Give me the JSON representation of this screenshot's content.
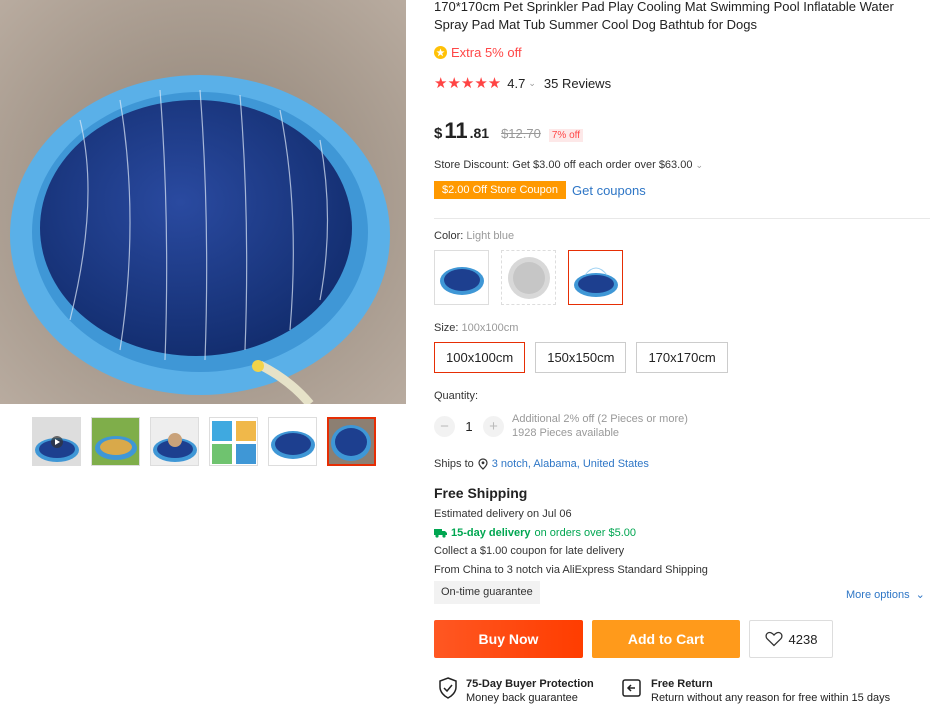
{
  "product": {
    "title": "170*170cm Pet Sprinkler Pad Play Cooling Mat Swimming Pool Inflatable Water Spray Pad Mat Tub Summer Cool Dog Bathtub for Dogs",
    "extra_off": "Extra 5% off",
    "rating": "4.7",
    "reviews": "35 Reviews",
    "price_currency": "$",
    "price_int": "11",
    "price_dec": ".81",
    "price_old": "$12.70",
    "price_off": "7% off",
    "star_rating_value": 4.7
  },
  "store": {
    "discount": "Store Discount: Get $3.00 off each order over $63.00",
    "coupon": "$2.00 Off Store Coupon",
    "get_coupons": "Get coupons"
  },
  "color": {
    "label": "Color:",
    "value": "Light blue"
  },
  "size": {
    "label": "Size:",
    "value": "100x100cm",
    "options": [
      "100x100cm",
      "150x150cm",
      "170x170cm"
    ]
  },
  "quantity": {
    "label": "Quantity:",
    "value": "1",
    "note1": "Additional 2% off (2 Pieces or more)",
    "note2": "1928 Pieces available",
    "minus": "−",
    "plus": "+"
  },
  "ships": {
    "label": "Ships to",
    "location": "3 notch, Alabama, United States"
  },
  "shipping": {
    "title": "Free Shipping",
    "estimate": "Estimated delivery on Jul 06",
    "delivery_bold": "15-day delivery",
    "delivery_rest": "on orders over $5.00",
    "late": "Collect a $1.00 coupon for late delivery",
    "from": "From China to 3 notch via AliExpress Standard Shipping",
    "ontime": "On-time guarantee",
    "more": "More options"
  },
  "actions": {
    "buy": "Buy Now",
    "cart": "Add to Cart",
    "wish_count": "4238"
  },
  "protection": {
    "p1_title": "75-Day Buyer Protection",
    "p1_sub": "Money back guarantee",
    "p2_title": "Free Return",
    "p2_sub": "Return without any reason for free within 15 days"
  },
  "colors": {
    "accent": "#e62e04",
    "buy": "#ff4d1f",
    "cart": "#ff9a1b",
    "link": "#2e76c6",
    "green": "#00a651",
    "coupon": "#ff9900"
  }
}
